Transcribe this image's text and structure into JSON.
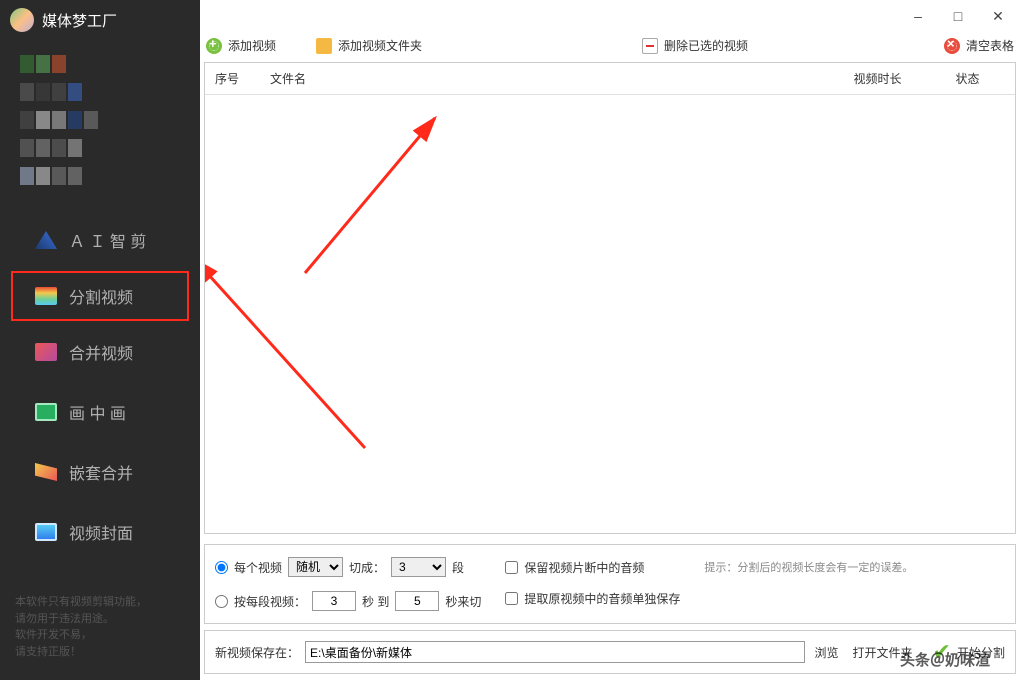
{
  "app": {
    "title": "媒体梦工厂"
  },
  "sidebar": {
    "items": [
      {
        "label": "Ａ Ｉ 智 剪"
      },
      {
        "label": "分割视频"
      },
      {
        "label": "合并视频"
      },
      {
        "label": "画 中 画"
      },
      {
        "label": "嵌套合并"
      },
      {
        "label": "视频封面"
      }
    ],
    "footer_l1": "本软件只有视频剪辑功能，",
    "footer_l2": "请勿用于违法用途。",
    "footer_l3": "软件开发不易，",
    "footer_l4": "请支持正版！"
  },
  "toolbar": {
    "add_video": "添加视频",
    "add_folder": "添加视频文件夹",
    "delete_sel": "删除已选的视频",
    "clear_table": "清空表格"
  },
  "table": {
    "headers": {
      "seq": "序号",
      "name": "文件名",
      "duration": "视频时长",
      "status": "状态"
    }
  },
  "options": {
    "radio_each": "每个视频",
    "random_label": "随机",
    "cut_into_label": "切成：",
    "segments_value": "3",
    "segments_suffix": "段",
    "radio_bysegment": "按每段视频：",
    "sec_from": "3",
    "sec_mid": "秒 到",
    "sec_to": "5",
    "sec_suffix": "秒来切",
    "keep_audio": "保留视频片断中的音频",
    "extract_audio": "提取原视频中的音频单独保存",
    "hint": "提示：分割后的视频长度会有一定的误差。"
  },
  "save": {
    "label": "新视频保存在：",
    "path": "E:\\桌面备份\\新媒体",
    "browse": "浏览",
    "open_dir": "打开文件夹",
    "start": "开始分割"
  },
  "watermark": "头条＠奶味渲"
}
